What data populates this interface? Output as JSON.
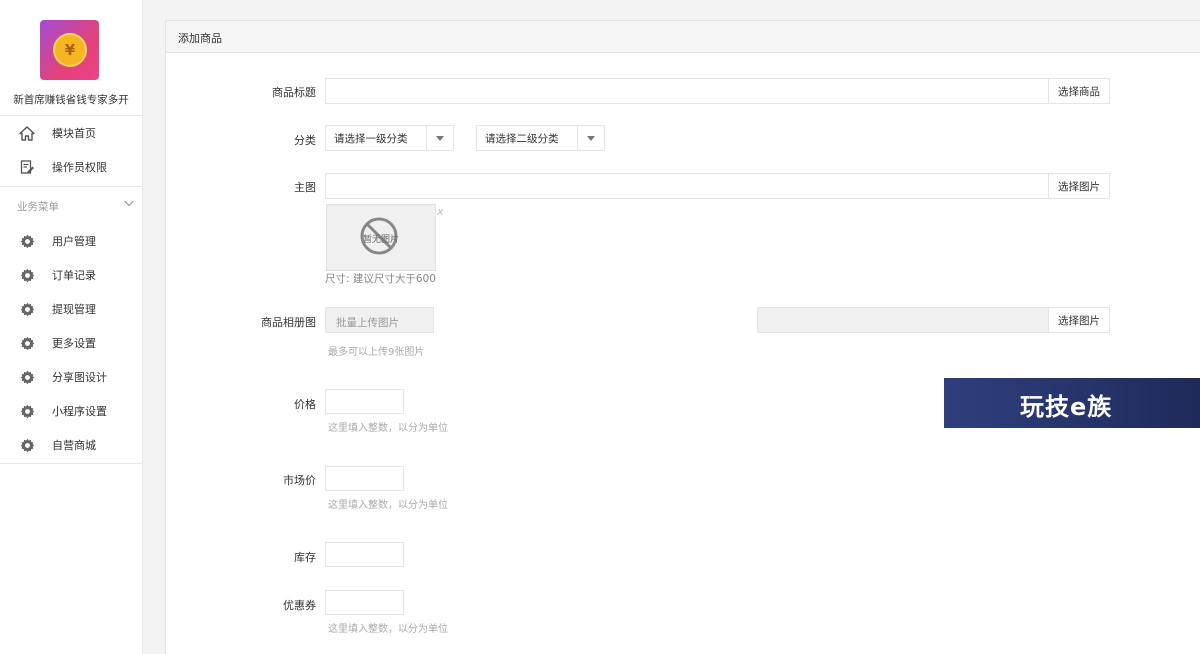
{
  "brand": {
    "logo_symbol": "¥",
    "name": "新首席赚钱省钱专家多开"
  },
  "sidebar": {
    "top_items": [
      {
        "label": "模块首页",
        "icon": "home-icon"
      },
      {
        "label": "操作员权限",
        "icon": "edit-icon"
      }
    ],
    "section_label": "业务菜单",
    "items": [
      {
        "label": "用户管理",
        "icon": "gear-icon"
      },
      {
        "label": "订单记录",
        "icon": "gear-icon"
      },
      {
        "label": "提现管理",
        "icon": "gear-icon"
      },
      {
        "label": "更多设置",
        "icon": "gear-icon"
      },
      {
        "label": "分享图设计",
        "icon": "gear-icon"
      },
      {
        "label": "小程序设置",
        "icon": "gear-icon"
      },
      {
        "label": "自营商城",
        "icon": "gear-icon"
      }
    ]
  },
  "panel": {
    "title": "添加商品"
  },
  "form": {
    "title": {
      "label": "商品标题",
      "value": "",
      "button": "选择商品"
    },
    "category": {
      "label": "分类",
      "first_placeholder": "请选择一级分类",
      "second_placeholder": "请选择二级分类"
    },
    "main_image": {
      "label": "主图",
      "value": "",
      "button": "选择图片",
      "thumb_text": "暂无图片",
      "close": "x",
      "help": "尺寸: 建议尺寸大于600"
    },
    "album": {
      "label": "商品相册图",
      "placeholder": "批量上传图片",
      "button": "选择图片",
      "help": "最多可以上传9张图片"
    },
    "price": {
      "label": "价格",
      "value": "",
      "help": "这里填入整数，以分为单位"
    },
    "market_price": {
      "label": "市场价",
      "value": "",
      "help": "这里填入整数，以分为单位"
    },
    "stock": {
      "label": "库存",
      "value": ""
    },
    "coupon": {
      "label": "优惠券",
      "value": "",
      "help": "这里填入整数，以分为单位"
    }
  },
  "watermark": {
    "text": "玩技e族"
  },
  "colors": {
    "logo_start": "#a24dd4",
    "logo_end": "#f0428a",
    "coin": "#f6b623",
    "watermark_bg": "#27346b"
  }
}
